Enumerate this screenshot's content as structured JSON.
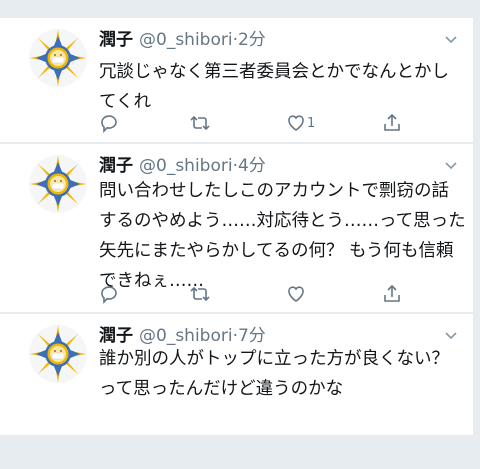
{
  "tweets": [
    {
      "display_name": "潤子",
      "handle": "@0_shibori",
      "separator": "·",
      "time": "2分",
      "text": "冗談じゃなく第三者委員会とかでなんとかし\nてくれ",
      "like_count": "1"
    },
    {
      "display_name": "潤子",
      "handle": "@0_shibori",
      "separator": "·",
      "time": "4分",
      "text": "問い合わせしたしこのアカウントで剽窃の話\nするのやめよう……対応待とう……って思った\n矢先にまたやらかしてるの何？ もう何も信頼\nできねぇ……",
      "like_count": ""
    },
    {
      "display_name": "潤子",
      "handle": "@0_shibori",
      "separator": "·",
      "time": "7分",
      "text": "誰か別の人がトップに立った方が良くない？\nって思ったんだけど違うのかな",
      "like_count": ""
    }
  ],
  "icons": {
    "avatar": "sun-emblem-avatar",
    "menu": "chevron-down-icon",
    "reply": "reply-icon",
    "retweet": "retweet-icon",
    "like": "heart-icon",
    "share": "share-icon"
  },
  "colors": {
    "background": "#e6ecf0",
    "card": "#ffffff",
    "text": "#14171a",
    "secondary": "#657786",
    "avatar_blue": "#3d6fb6",
    "avatar_gold": "#f2b705"
  }
}
